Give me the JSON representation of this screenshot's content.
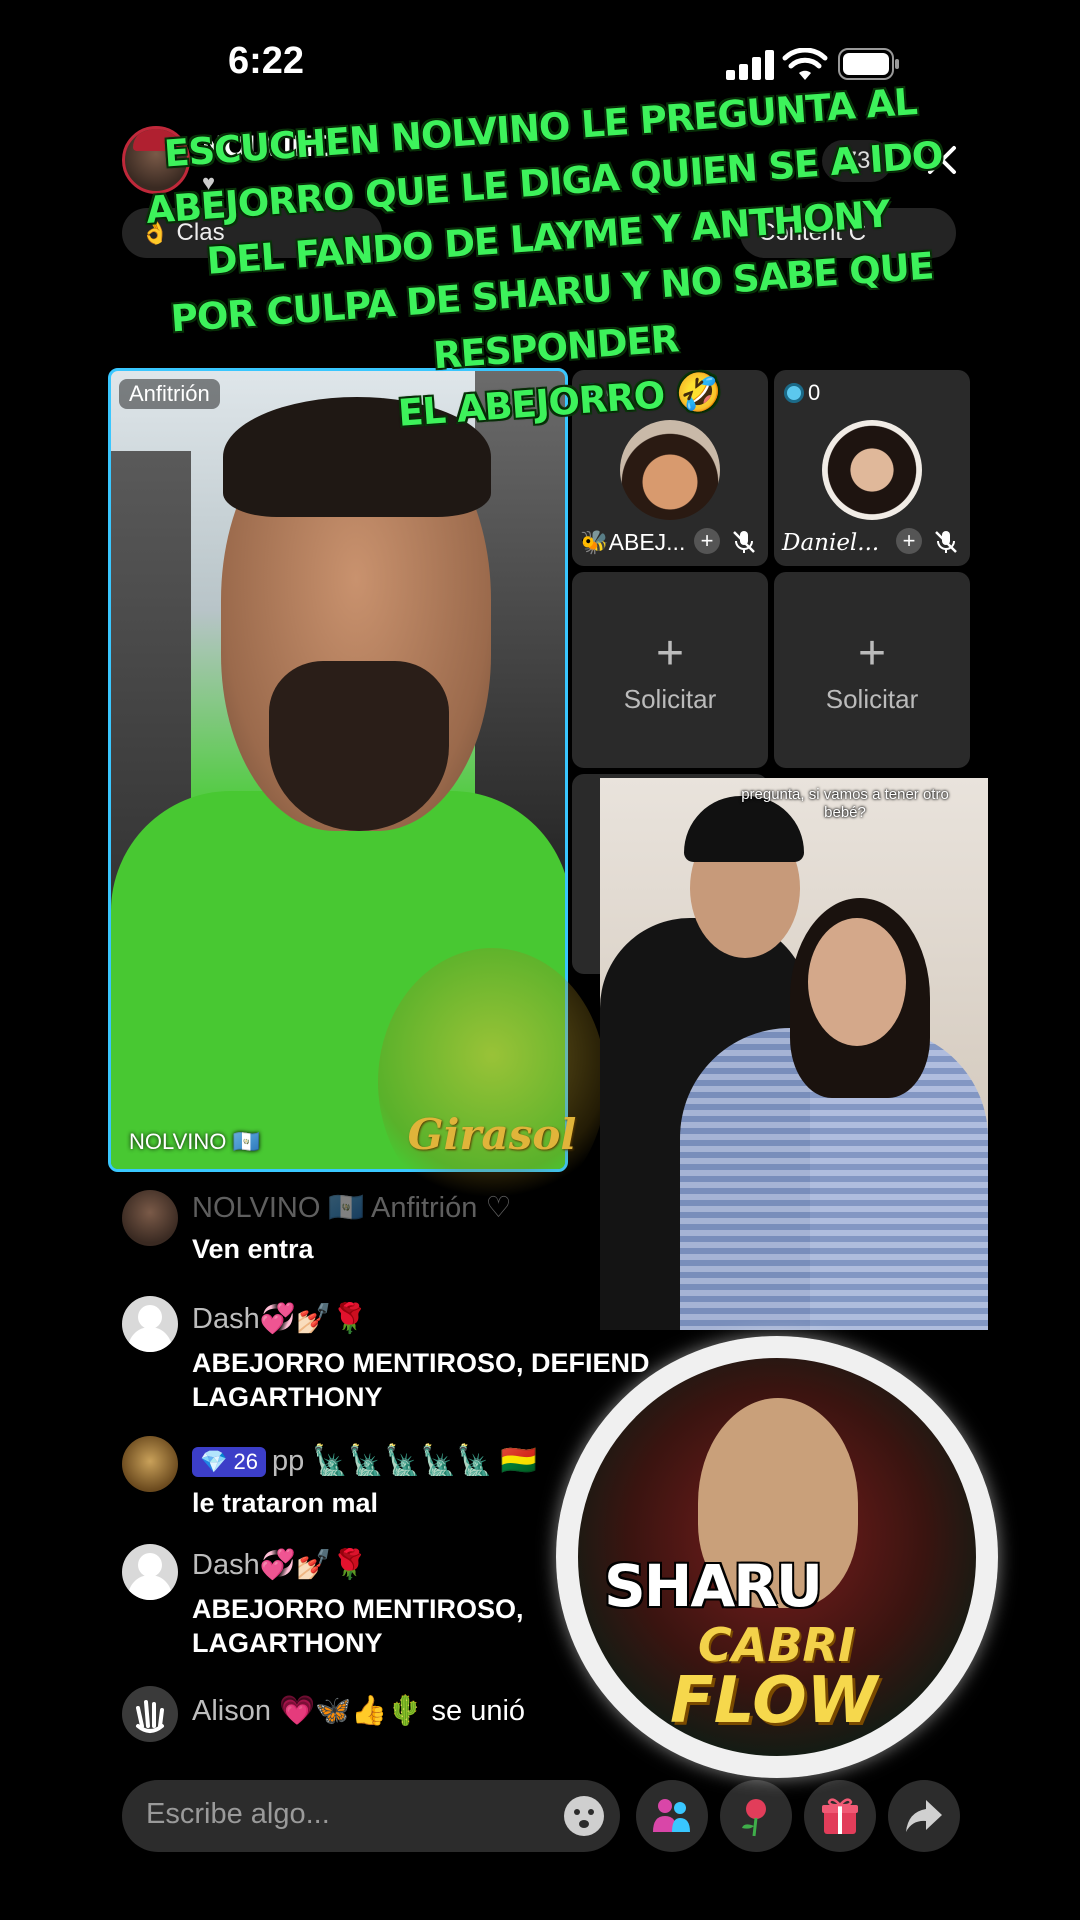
{
  "status_bar": {
    "time": "6:22"
  },
  "header": {
    "host_name": "NOLVINO",
    "host_likes": "♥",
    "viewer_count": "73",
    "pill_left": "👌 Clas",
    "pill_right": "Content C"
  },
  "caption": {
    "lines": [
      "Escuchen Nolvino le pregunta al",
      "Abejorro que le diga  quien se a ido",
      "Del fando de Layme y Anthony",
      "Por culpa de Sharu y no sabe que responder",
      "El abejorro 🤣"
    ]
  },
  "host_tile": {
    "tag": "Anfitrión",
    "name": "NOLVINO 🇬🇹"
  },
  "guests": [
    {
      "count": "0",
      "name": "🐝ABEJ...",
      "mic": "muted"
    },
    {
      "count": "0",
      "name": "Daniel...",
      "mic": "muted"
    }
  ],
  "request_slots": [
    {
      "label": "Solicitar"
    },
    {
      "label": "Solicitar"
    }
  ],
  "watermark": {
    "text": "Girasol"
  },
  "pip": {
    "caption": "pregunta, si vamos a tener otro bebé?"
  },
  "comments": [
    {
      "user": "NOLVINO 🇬🇹  Anfitrión ♡",
      "text": "Ven entra"
    },
    {
      "user": "Dash💞💅🏻🌹",
      "text": "ABEJORRO MENTIROSO, DEFIEND",
      "text2": "LAGARTHONY"
    },
    {
      "badge": "💎 26",
      "user": "pp 🗽🗽🗽🗽🗽 🇧🇴",
      "text": "le trataron mal"
    },
    {
      "user": "Dash💞💅🏻🌹",
      "text": "ABEJORRO MENTIROSO,",
      "text2": "LAGARTHONY"
    }
  ],
  "joined": {
    "user": "Alison 💗🦋👍🌵",
    "suffix": "se unió"
  },
  "sticker": {
    "name": "SHARU",
    "brand1": "CABRI",
    "brand2": "FLOW"
  },
  "input": {
    "placeholder": "Escribe algo..."
  },
  "icons": [
    "signal-icon",
    "wifi-icon",
    "battery-icon",
    "close-icon",
    "mute-icon",
    "emoji-icon",
    "guests-icon",
    "rose-icon",
    "gift-icon",
    "share-icon",
    "wave-icon"
  ],
  "colors": {
    "caption": "#3df25b",
    "host_border": "#39c7ff",
    "badge": "#3c3ec8",
    "gift": "#e23d5a",
    "guests": "#d946a8"
  }
}
